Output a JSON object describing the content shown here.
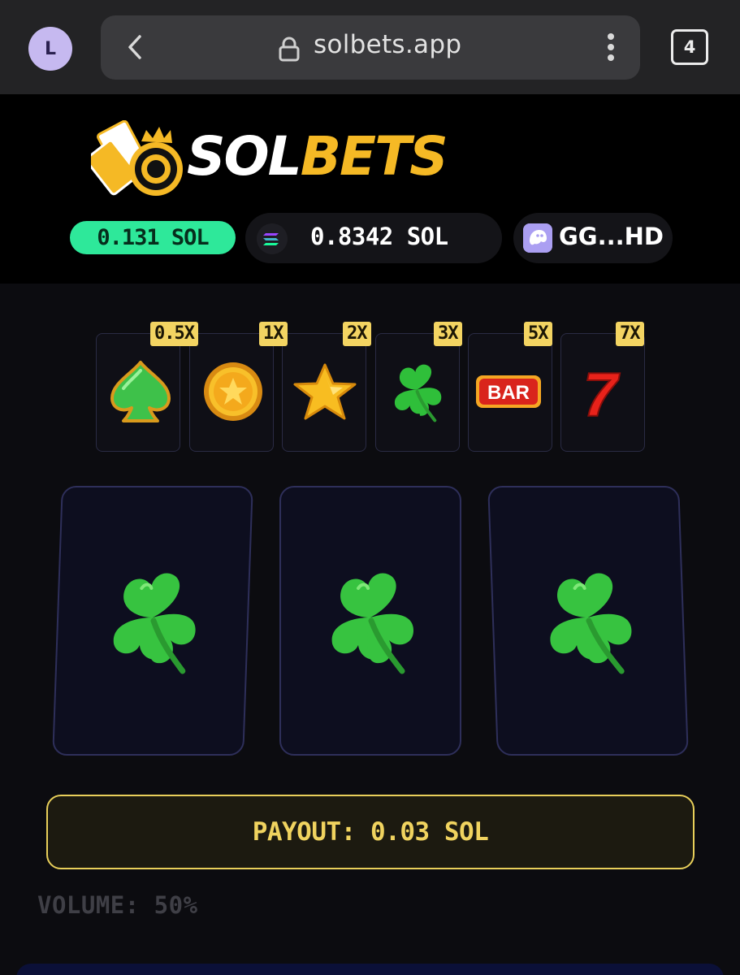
{
  "browser": {
    "profile_initial": "L",
    "url": "solbets.app",
    "tab_count": "4"
  },
  "brand": {
    "name_part1": "SOL",
    "name_part2": "BETS"
  },
  "header": {
    "session_amount": "0.131 SOL",
    "wallet_balance": "0.8342 SOL",
    "wallet_address": "GG...HD"
  },
  "paytable": [
    {
      "symbol": "spade-icon",
      "multiplier": "0.5X"
    },
    {
      "symbol": "coin-icon",
      "multiplier": "1X"
    },
    {
      "symbol": "star-icon",
      "multiplier": "2X"
    },
    {
      "symbol": "clover-icon",
      "multiplier": "3X"
    },
    {
      "symbol": "bar-icon",
      "multiplier": "5X",
      "label": "BAR"
    },
    {
      "symbol": "seven-icon",
      "multiplier": "7X",
      "label": "7"
    }
  ],
  "reels": [
    "clover-icon",
    "clover-icon",
    "clover-icon"
  ],
  "payout_text": "PAYOUT: 0.03 SOL",
  "volume_text": "VOLUME: 50%",
  "colors": {
    "accent_green": "#2ee89a",
    "gold": "#f3d462",
    "reel_border": "#2e2f5a"
  }
}
